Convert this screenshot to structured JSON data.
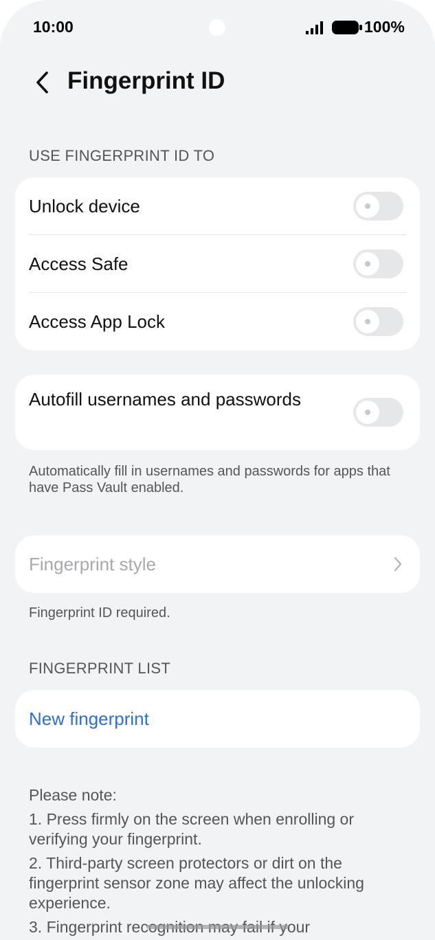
{
  "status_bar": {
    "time": "10:00",
    "battery": "100%",
    "signal_icon": "signal-bars-icon",
    "battery_icon": "battery-full-icon"
  },
  "header": {
    "back_icon": "chevron-left-icon",
    "title": "Fingerprint ID"
  },
  "use_section": {
    "label": "USE FINGERPRINT ID TO",
    "items": [
      {
        "label": "Unlock device",
        "enabled": false
      },
      {
        "label": "Access Safe",
        "enabled": false
      },
      {
        "label": "Access App Lock",
        "enabled": false
      }
    ]
  },
  "autofill": {
    "label": "Autofill usernames and passwords",
    "enabled": false,
    "caption": "Automatically fill in usernames and passwords for apps that have Pass Vault enabled."
  },
  "fingerprint_style": {
    "label": "Fingerprint style",
    "caption": "Fingerprint ID required."
  },
  "fingerprint_list": {
    "label": "FINGERPRINT LIST",
    "new_label": "New fingerprint"
  },
  "notes": {
    "heading": "Please note:",
    "items": [
      "1. Press firmly on the screen when enrolling or verifying your fingerprint.",
      "2. Third-party screen protectors or dirt on the fingerprint sensor zone may affect the unlocking experience.",
      "3. Fingerprint recognition may fail if your"
    ]
  },
  "colors": {
    "background": "#f2f3f5",
    "card": "#ffffff",
    "accent": "#2a6fdb",
    "toggle_off": "#e6e7e9"
  }
}
